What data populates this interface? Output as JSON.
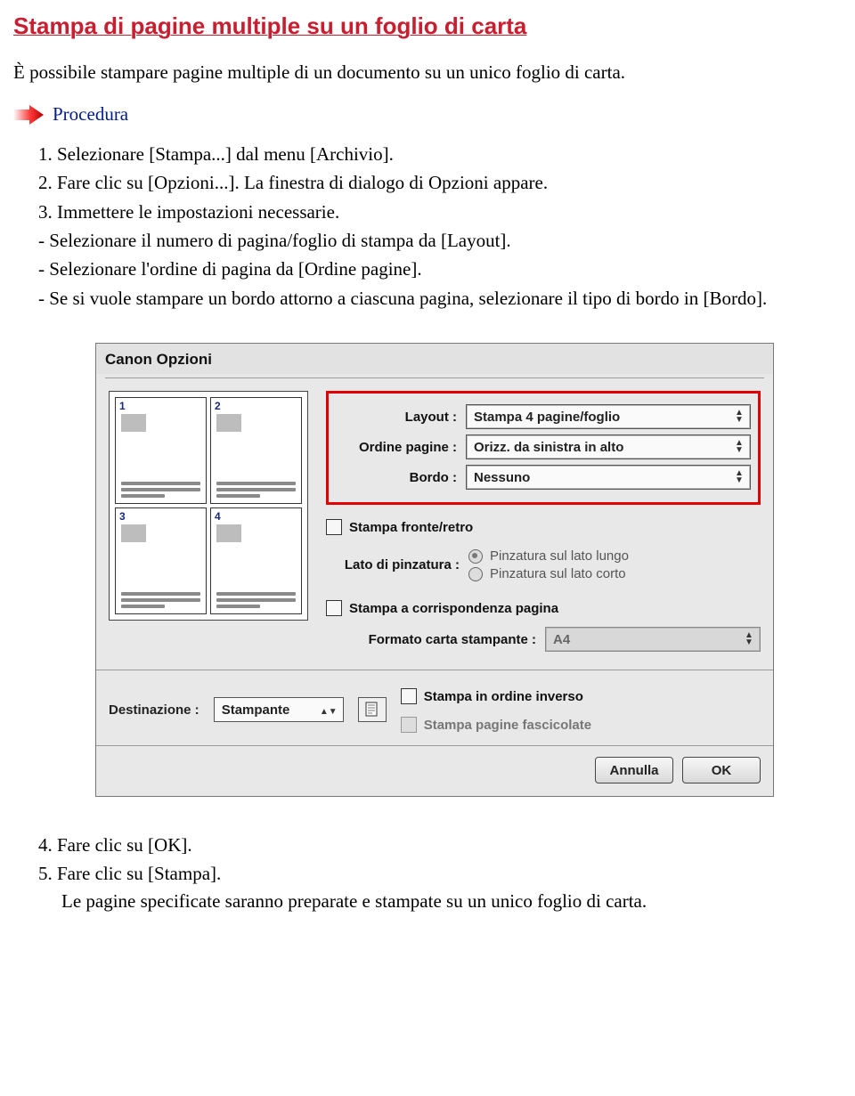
{
  "title": "Stampa di pagine multiple su un foglio di carta",
  "intro": "È possibile stampare pagine multiple di un documento su un unico foglio di carta.",
  "procedure_label": "Procedura",
  "steps": {
    "s1": "1.  Selezionare [Stampa...] dal menu [Archivio].",
    "s2": "2.  Fare clic su [Opzioni...]. La finestra di dialogo di Opzioni appare.",
    "s3": "3.  Immettere le impostazioni necessarie.",
    "s3a": "-  Selezionare il numero di pagina/foglio di stampa da [Layout].",
    "s3b": "-  Selezionare l'ordine di pagina da [Ordine pagine].",
    "s3c": "-  Se si vuole stampare un bordo attorno a ciascuna pagina, selezionare il tipo di bordo in [Bordo].",
    "s4": "4.  Fare clic su [OK].",
    "s5": "5.  Fare clic su [Stampa].",
    "end_note": "Le pagine specificate saranno preparate e stampate su un unico foglio di carta."
  },
  "dialog": {
    "title": "Canon Opzioni",
    "preview_pages": [
      "1",
      "2",
      "3",
      "4"
    ],
    "layout": {
      "label": "Layout :",
      "value": "Stampa 4 pagine/foglio"
    },
    "order": {
      "label": "Ordine pagine :",
      "value": "Orizz. da sinistra in alto"
    },
    "border": {
      "label": "Bordo :",
      "value": "Nessuno"
    },
    "duplex_label": "Stampa fronte/retro",
    "binding": {
      "label": "Lato di pinzatura :",
      "opt1": "Pinzatura sul lato lungo",
      "opt2": "Pinzatura sul lato corto"
    },
    "fit_label": "Stampa a corrispondenza pagina",
    "paper": {
      "label": "Formato carta stampante :",
      "value": "A4"
    },
    "dest": {
      "label": "Destinazione :",
      "value": "Stampante"
    },
    "reverse_label": "Stampa in ordine inverso",
    "collate_label": "Stampa pagine fascicolate",
    "btn_cancel": "Annulla",
    "btn_ok": "OK"
  }
}
